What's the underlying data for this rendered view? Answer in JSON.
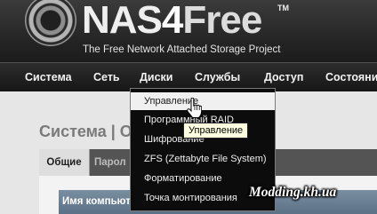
{
  "header": {
    "logo": {
      "name_part1": "NAS",
      "name_part2": "4",
      "name_part3": "Free",
      "trademark": "TM",
      "subtitle": "The Free Network Attached Storage Project"
    }
  },
  "nav": {
    "items": [
      "Система",
      "Сеть",
      "Диски",
      "Службы",
      "Доступ",
      "Состояни"
    ]
  },
  "page": {
    "title": "Система | О"
  },
  "tabs": {
    "active": "Общие",
    "inactive": "Парол"
  },
  "field": {
    "label": "Имя компьют"
  },
  "dropdown": {
    "parent": "Диски",
    "items": [
      "Управление",
      "Программный RAID",
      "Шифрование",
      "ZFS (Zettabyte File System)",
      "Форматирование",
      "Точка монтирования"
    ],
    "hovered_index": 0
  },
  "tooltip": {
    "text": "Управление"
  },
  "watermark": {
    "text": "Modding.kh.ua"
  }
}
